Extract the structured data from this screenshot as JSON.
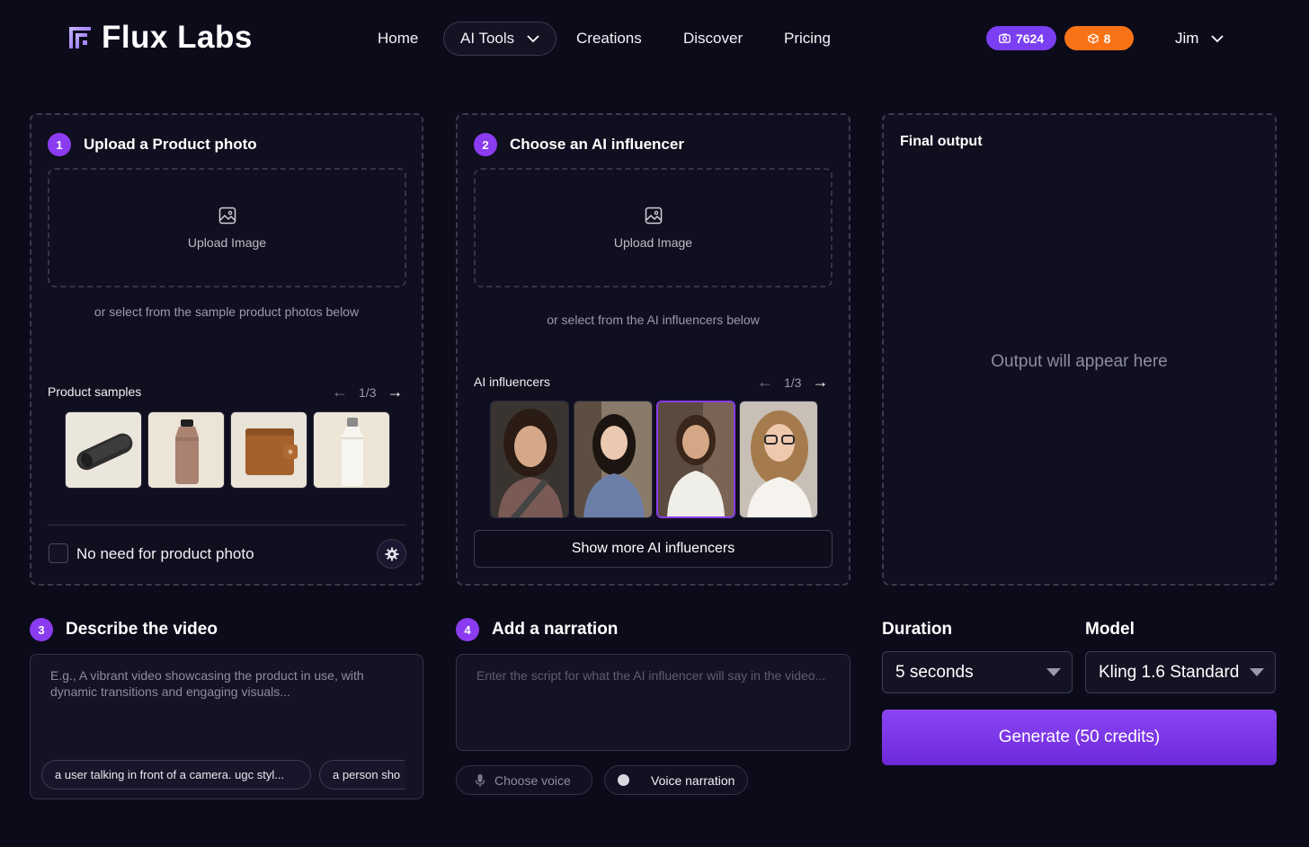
{
  "header": {
    "brand": "Flux Labs",
    "nav": [
      {
        "label": "Home"
      },
      {
        "label": "AI Tools"
      },
      {
        "label": "Creations"
      },
      {
        "label": "Discover"
      },
      {
        "label": "Pricing"
      }
    ],
    "credits": "7624",
    "gems": "8",
    "user": "Jim"
  },
  "step1": {
    "number": "1",
    "title": "Upload a Product photo",
    "upload_label": "Upload Image",
    "hint": "or select from the sample product photos below",
    "samples_label": "Product samples",
    "pager": "1/3",
    "samples": [
      "speaker",
      "brown-bottle",
      "wallet",
      "white-bottle"
    ],
    "no_photo_label": "No need for product photo"
  },
  "step2": {
    "number": "2",
    "title": "Choose an AI influencer",
    "upload_label": "Upload Image",
    "hint": "or select from the AI influencers below",
    "influencers_label": "AI influencers",
    "pager": "1/3",
    "show_more": "Show more AI influencers"
  },
  "output": {
    "title": "Final output",
    "placeholder": "Output will appear here"
  },
  "step3": {
    "number": "3",
    "title": "Describe the video",
    "placeholder": "E.g., A vibrant video showcasing the product in use, with dynamic transitions and engaging visuals...",
    "chips": [
      "a user talking in front of a camera. ugc styl...",
      "a person sho"
    ]
  },
  "step4": {
    "number": "4",
    "title": "Add a narration",
    "placeholder": "Enter the script for what the AI influencer will say in the video...",
    "choose_voice": "Choose voice",
    "voice_narration": "Voice narration"
  },
  "settings": {
    "duration_label": "Duration",
    "duration_value": "5 seconds",
    "model_label": "Model",
    "model_value": "Kling 1.6 Standard",
    "generate_label": "Generate (50 credits)"
  },
  "colors": {
    "accent": "#8b3cf0",
    "orange": "#f97316",
    "background": "#0c0b1a"
  }
}
